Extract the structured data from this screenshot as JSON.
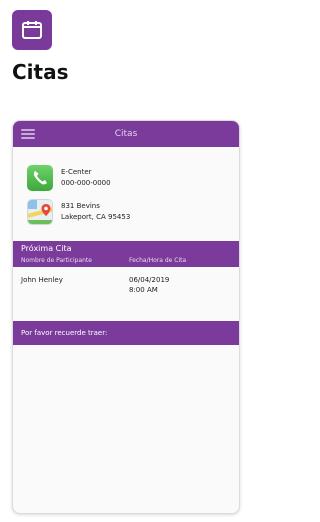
{
  "page": {
    "title": "Citas",
    "icon": "calendar-icon"
  },
  "app": {
    "header_title": "Citas",
    "menu_icon": "hamburger-menu-icon",
    "contact": {
      "name": "E-Center",
      "phone": "000-000-0000",
      "address_line1": "831 Bevins",
      "address_line2": "Lakeport, CA 95453"
    },
    "next_appointment": {
      "title": "Próxima Cita",
      "columns": [
        "Nombre de Participante",
        "Fecha/Hora de Cita"
      ],
      "rows": [
        {
          "participant": "John Henley",
          "date": "06/04/2019",
          "time": "8:00 AM"
        }
      ]
    },
    "reminder": {
      "label": "Por favor recuerde traer:"
    }
  },
  "colors": {
    "accent": "#7b3b9b",
    "icon_bg": "#7a3a99"
  }
}
